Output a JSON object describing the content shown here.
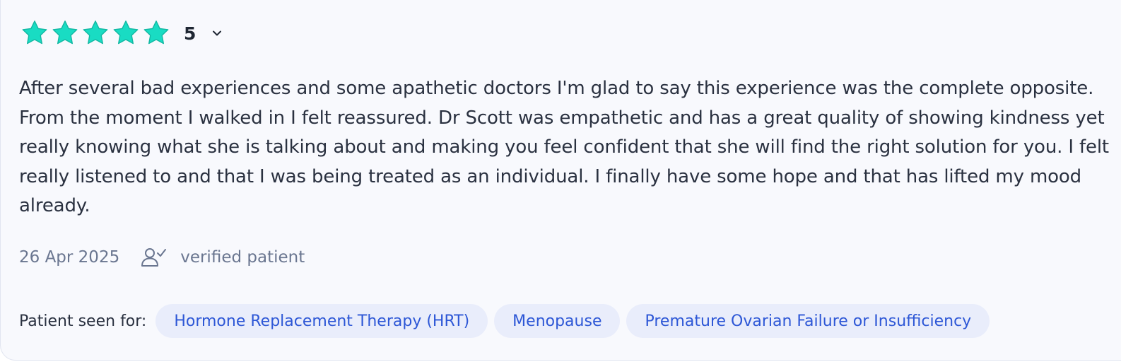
{
  "review": {
    "rating": {
      "value": "5",
      "stars_filled": 5,
      "stars_total": 5,
      "star_color": "#19dcc3",
      "toggle_icon": "chevron-down-icon"
    },
    "text": "After several bad experiences and some apathetic doctors I'm glad to say this experience was the complete opposite. From the moment I walked in I felt reassured. Dr Scott was empathetic and has a great quality of showing kindness yet really knowing what she is talking about and making you feel confident that she will find the right solution for you. I felt really listened to and that I was being treated as an individual. I finally have some hope and that has lifted my mood already.",
    "date": "26 Apr 2025",
    "verified_icon": "user-check-icon",
    "verified_label": "verified patient",
    "seen_for": {
      "label": "Patient seen for:",
      "tags": [
        "Hormone Replacement Therapy (HRT)",
        "Menopause",
        "Premature Ovarian Failure or Insufficiency"
      ]
    }
  },
  "colors": {
    "card_background": "#f8f9fd",
    "chip_background": "#e9edfb",
    "chip_text": "#2d57d6",
    "meta_text": "#6a7690",
    "body_text": "#2a3140"
  }
}
